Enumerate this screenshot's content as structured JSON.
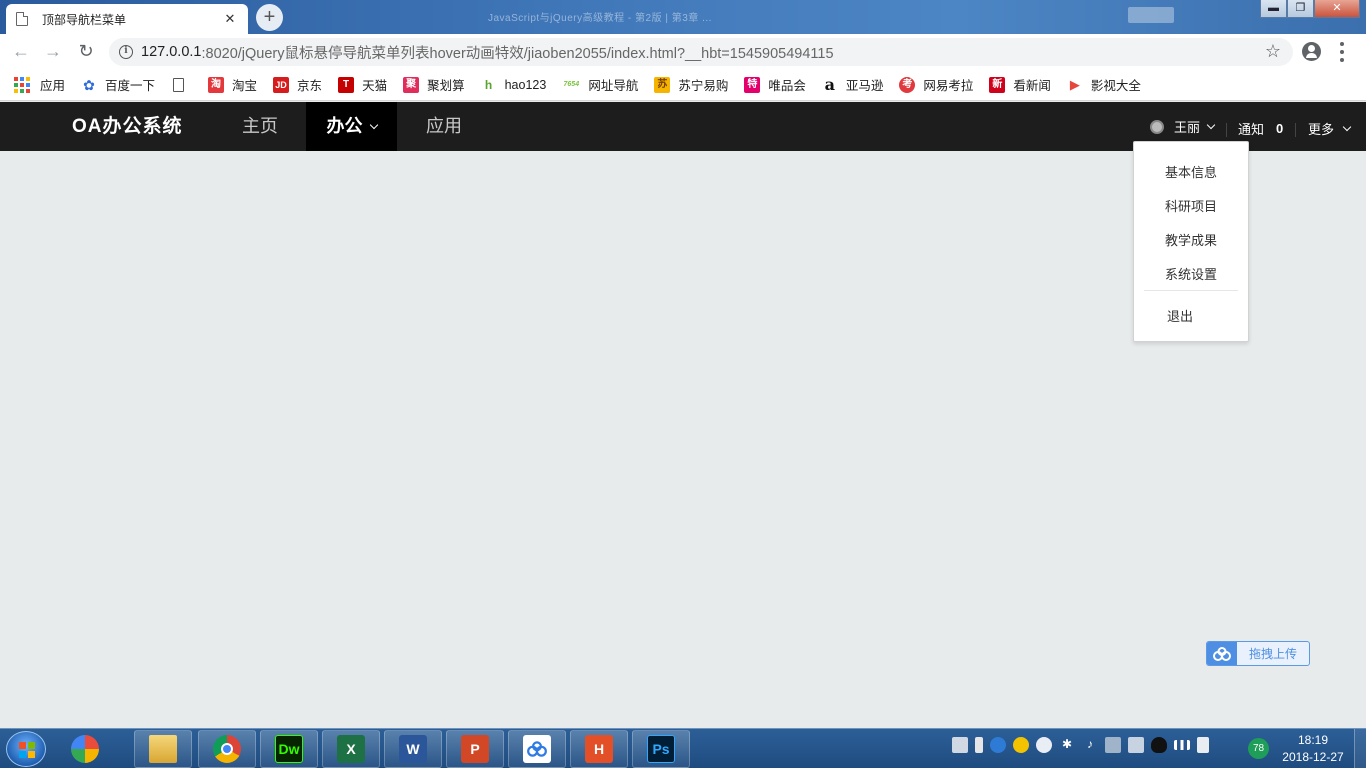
{
  "browser": {
    "tab_title": "顶部导航栏菜单",
    "tab_close": "✕",
    "new_tab": "+",
    "background_window_title": "JavaScript与jQuery高级教程 - 第2版 | 第3章 ...",
    "url_host": "127.0.0.1",
    "url_rest": ":8020/jQuery鼠标悬停导航菜单列表hover动画特效/jiaoben2055/index.html?__hbt=1545905494115",
    "window_buttons": {
      "minimize": "▬",
      "restore": "❐",
      "close": "✕"
    }
  },
  "bookmarks": [
    {
      "label": "应用",
      "icon": "apps-grid-icon"
    },
    {
      "label": "百度一下",
      "icon": "baidu-paw-icon",
      "color": "#2f6bd8"
    },
    {
      "label": "",
      "icon": "blank-page-icon"
    },
    {
      "label": "淘宝",
      "icon": "taobao-icon",
      "color": "#e4393c",
      "glyph": "淘"
    },
    {
      "label": "京东",
      "icon": "jd-icon",
      "color": "#d71c1e",
      "glyph": "JD"
    },
    {
      "label": "天猫",
      "icon": "tmall-icon",
      "color": "#c40000",
      "glyph": "T"
    },
    {
      "label": "聚划算",
      "icon": "juhuasuan-icon",
      "color": "#e02d5c",
      "glyph": "聚"
    },
    {
      "label": "hao123",
      "icon": "hao123-icon",
      "color": "#59a52c",
      "glyph": "h"
    },
    {
      "label": "网址导航",
      "icon": "7654-icon",
      "color": "#7cc242",
      "glyph": "7654"
    },
    {
      "label": "苏宁易购",
      "icon": "suning-icon",
      "color": "#f4b400",
      "glyph": "苏"
    },
    {
      "label": "唯品会",
      "icon": "vip-icon",
      "color": "#e4006c",
      "glyph": "特"
    },
    {
      "label": "亚马逊",
      "icon": "amazon-icon",
      "color": "#111111",
      "glyph": "a"
    },
    {
      "label": "网易考拉",
      "icon": "kaola-icon",
      "color": "#e03a3e",
      "glyph": "考"
    },
    {
      "label": "看新闻",
      "icon": "news-icon",
      "color": "#d0021b",
      "glyph": "新"
    },
    {
      "label": "影视大全",
      "icon": "video-play-icon",
      "color": "#e6453e",
      "glyph": "▶"
    }
  ],
  "site": {
    "logo": "OA办公系统",
    "nav": [
      {
        "label": "主页",
        "active": false
      },
      {
        "label": "办公",
        "active": true
      },
      {
        "label": "应用",
        "active": false
      }
    ],
    "user_name": "王丽",
    "notification_label": "通知",
    "notification_count": "0",
    "more_label": "更多",
    "user_menu": [
      "基本信息",
      "科研项目",
      "教学成果",
      "系统设置"
    ],
    "logout_label": "退出"
  },
  "upload_widget": {
    "label": "拖拽上传"
  },
  "taskbar": {
    "apps": [
      {
        "name": "pinwheel-app-icon",
        "color": "#e94b3c"
      },
      {
        "name": "file-explorer-icon",
        "color": "#e8c25a"
      },
      {
        "name": "chrome-icon",
        "color": "#db4437"
      },
      {
        "name": "dreamweaver-icon",
        "color": "#072401",
        "glyph": "Dw",
        "glyph_color": "#35fa00"
      },
      {
        "name": "excel-icon",
        "color": "#1e7145",
        "glyph": "X"
      },
      {
        "name": "word-icon",
        "color": "#2b579a",
        "glyph": "W"
      },
      {
        "name": "powerpoint-icon",
        "color": "#d24726",
        "glyph": "P"
      },
      {
        "name": "baidu-netdisk-icon",
        "color": "#ffffff"
      },
      {
        "name": "hbuilder-icon",
        "color": "#e34f26",
        "glyph": "H"
      },
      {
        "name": "photoshop-icon",
        "color": "#001e36",
        "glyph": "Ps",
        "glyph_color": "#31a8ff"
      }
    ],
    "battery_percent": "78",
    "time": "18:19",
    "date": "2018-12-27"
  }
}
